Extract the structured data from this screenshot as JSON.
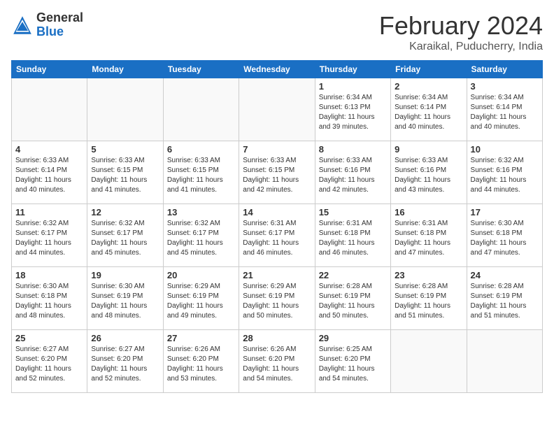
{
  "logo": {
    "general": "General",
    "blue": "Blue"
  },
  "header": {
    "month": "February 2024",
    "location": "Karaikal, Puducherry, India"
  },
  "weekdays": [
    "Sunday",
    "Monday",
    "Tuesday",
    "Wednesday",
    "Thursday",
    "Friday",
    "Saturday"
  ],
  "weeks": [
    [
      {
        "day": "",
        "info": ""
      },
      {
        "day": "",
        "info": ""
      },
      {
        "day": "",
        "info": ""
      },
      {
        "day": "",
        "info": ""
      },
      {
        "day": "1",
        "info": "Sunrise: 6:34 AM\nSunset: 6:13 PM\nDaylight: 11 hours and 39 minutes."
      },
      {
        "day": "2",
        "info": "Sunrise: 6:34 AM\nSunset: 6:14 PM\nDaylight: 11 hours and 40 minutes."
      },
      {
        "day": "3",
        "info": "Sunrise: 6:34 AM\nSunset: 6:14 PM\nDaylight: 11 hours and 40 minutes."
      }
    ],
    [
      {
        "day": "4",
        "info": "Sunrise: 6:33 AM\nSunset: 6:14 PM\nDaylight: 11 hours and 40 minutes."
      },
      {
        "day": "5",
        "info": "Sunrise: 6:33 AM\nSunset: 6:15 PM\nDaylight: 11 hours and 41 minutes."
      },
      {
        "day": "6",
        "info": "Sunrise: 6:33 AM\nSunset: 6:15 PM\nDaylight: 11 hours and 41 minutes."
      },
      {
        "day": "7",
        "info": "Sunrise: 6:33 AM\nSunset: 6:15 PM\nDaylight: 11 hours and 42 minutes."
      },
      {
        "day": "8",
        "info": "Sunrise: 6:33 AM\nSunset: 6:16 PM\nDaylight: 11 hours and 42 minutes."
      },
      {
        "day": "9",
        "info": "Sunrise: 6:33 AM\nSunset: 6:16 PM\nDaylight: 11 hours and 43 minutes."
      },
      {
        "day": "10",
        "info": "Sunrise: 6:32 AM\nSunset: 6:16 PM\nDaylight: 11 hours and 44 minutes."
      }
    ],
    [
      {
        "day": "11",
        "info": "Sunrise: 6:32 AM\nSunset: 6:17 PM\nDaylight: 11 hours and 44 minutes."
      },
      {
        "day": "12",
        "info": "Sunrise: 6:32 AM\nSunset: 6:17 PM\nDaylight: 11 hours and 45 minutes."
      },
      {
        "day": "13",
        "info": "Sunrise: 6:32 AM\nSunset: 6:17 PM\nDaylight: 11 hours and 45 minutes."
      },
      {
        "day": "14",
        "info": "Sunrise: 6:31 AM\nSunset: 6:17 PM\nDaylight: 11 hours and 46 minutes."
      },
      {
        "day": "15",
        "info": "Sunrise: 6:31 AM\nSunset: 6:18 PM\nDaylight: 11 hours and 46 minutes."
      },
      {
        "day": "16",
        "info": "Sunrise: 6:31 AM\nSunset: 6:18 PM\nDaylight: 11 hours and 47 minutes."
      },
      {
        "day": "17",
        "info": "Sunrise: 6:30 AM\nSunset: 6:18 PM\nDaylight: 11 hours and 47 minutes."
      }
    ],
    [
      {
        "day": "18",
        "info": "Sunrise: 6:30 AM\nSunset: 6:18 PM\nDaylight: 11 hours and 48 minutes."
      },
      {
        "day": "19",
        "info": "Sunrise: 6:30 AM\nSunset: 6:19 PM\nDaylight: 11 hours and 48 minutes."
      },
      {
        "day": "20",
        "info": "Sunrise: 6:29 AM\nSunset: 6:19 PM\nDaylight: 11 hours and 49 minutes."
      },
      {
        "day": "21",
        "info": "Sunrise: 6:29 AM\nSunset: 6:19 PM\nDaylight: 11 hours and 50 minutes."
      },
      {
        "day": "22",
        "info": "Sunrise: 6:28 AM\nSunset: 6:19 PM\nDaylight: 11 hours and 50 minutes."
      },
      {
        "day": "23",
        "info": "Sunrise: 6:28 AM\nSunset: 6:19 PM\nDaylight: 11 hours and 51 minutes."
      },
      {
        "day": "24",
        "info": "Sunrise: 6:28 AM\nSunset: 6:19 PM\nDaylight: 11 hours and 51 minutes."
      }
    ],
    [
      {
        "day": "25",
        "info": "Sunrise: 6:27 AM\nSunset: 6:20 PM\nDaylight: 11 hours and 52 minutes."
      },
      {
        "day": "26",
        "info": "Sunrise: 6:27 AM\nSunset: 6:20 PM\nDaylight: 11 hours and 52 minutes."
      },
      {
        "day": "27",
        "info": "Sunrise: 6:26 AM\nSunset: 6:20 PM\nDaylight: 11 hours and 53 minutes."
      },
      {
        "day": "28",
        "info": "Sunrise: 6:26 AM\nSunset: 6:20 PM\nDaylight: 11 hours and 54 minutes."
      },
      {
        "day": "29",
        "info": "Sunrise: 6:25 AM\nSunset: 6:20 PM\nDaylight: 11 hours and 54 minutes."
      },
      {
        "day": "",
        "info": ""
      },
      {
        "day": "",
        "info": ""
      }
    ]
  ]
}
